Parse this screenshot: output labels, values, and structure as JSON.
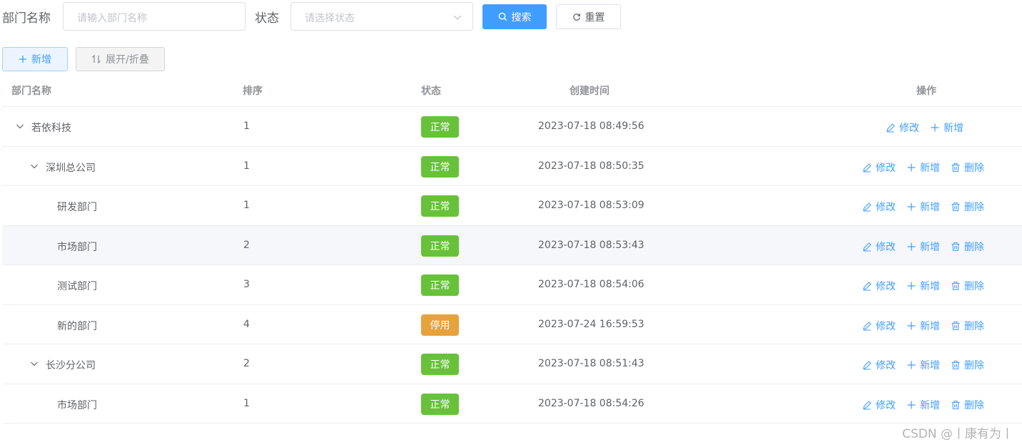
{
  "search": {
    "dept_label": "部门名称",
    "dept_placeholder": "请输入部门名称",
    "status_label": "状态",
    "status_placeholder": "请选择状态",
    "search_btn": "搜索",
    "reset_btn": "重置"
  },
  "toolbar": {
    "add_btn": "新增",
    "toggle_btn": "展开/折叠"
  },
  "table": {
    "headers": [
      "部门名称",
      "排序",
      "状态",
      "创建时间",
      "操作"
    ],
    "ops": {
      "edit": "修改",
      "add": "新增",
      "delete": "删除"
    },
    "rows": [
      {
        "name": "若依科技",
        "order": "1",
        "status": "正常",
        "created": "2023-07-18 08:49:56"
      },
      {
        "name": "深圳总公司",
        "order": "1",
        "status": "正常",
        "created": "2023-07-18 08:50:35"
      },
      {
        "name": "研发部门",
        "order": "1",
        "status": "正常",
        "created": "2023-07-18 08:53:09"
      },
      {
        "name": "市场部门",
        "order": "2",
        "status": "正常",
        "created": "2023-07-18 08:53:43"
      },
      {
        "name": "测试部门",
        "order": "3",
        "status": "正常",
        "created": "2023-07-18 08:54:06"
      },
      {
        "name": "新的部门",
        "order": "4",
        "status": "停用",
        "created": "2023-07-24 16:59:53"
      },
      {
        "name": "长沙分公司",
        "order": "2",
        "status": "正常",
        "created": "2023-07-18 08:51:43"
      },
      {
        "name": "市场部门",
        "order": "1",
        "status": "正常",
        "created": "2023-07-18 08:54:26"
      }
    ]
  },
  "colors": {
    "primary": "#409eff",
    "success": "#67c23a",
    "warning": "#e6a23c"
  },
  "watermark": "CSDN @丨康有为丨"
}
